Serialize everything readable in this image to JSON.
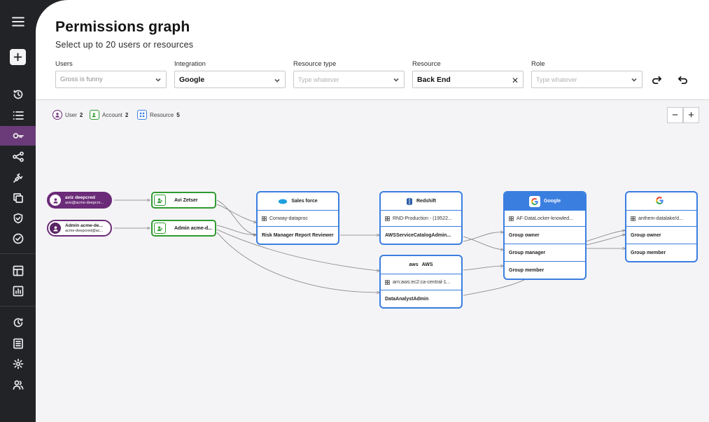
{
  "page": {
    "title": "Permissions graph",
    "subtitle": "Select up to 20 users or resources"
  },
  "sidebar": {
    "menu_icon": "hamburger-icon",
    "add_icon": "plus-icon",
    "items": [
      {
        "icon": "history-icon"
      },
      {
        "icon": "list-icon"
      },
      {
        "icon": "key-icon",
        "active": true
      },
      {
        "icon": "share-icon"
      },
      {
        "icon": "plug-icon"
      },
      {
        "icon": "copy-icon"
      },
      {
        "icon": "shield-icon"
      },
      {
        "icon": "check-circle-icon"
      },
      {
        "icon": "layout-icon"
      },
      {
        "icon": "bar-chart-icon"
      },
      {
        "icon": "refresh-icon"
      },
      {
        "icon": "document-list-icon"
      },
      {
        "icon": "settings-icon"
      },
      {
        "icon": "users-icon"
      }
    ]
  },
  "filters": {
    "users": {
      "label": "Users",
      "value": "Gross is funny"
    },
    "integration": {
      "label": "Integration",
      "value": "Google"
    },
    "resource_type": {
      "label": "Resource type",
      "placeholder": "Type whatever"
    },
    "resource": {
      "label": "Resource",
      "value": "Back End"
    },
    "role": {
      "label": "Role",
      "placeholder": "Type whatever"
    }
  },
  "toolbar": {
    "redo_icon": "redo-icon",
    "undo_icon": "undo-icon"
  },
  "legend": {
    "user": {
      "label": "User",
      "count": "2"
    },
    "account": {
      "label": "Account",
      "count": "2"
    },
    "resource": {
      "label": "Resource",
      "count": "5"
    }
  },
  "zoom": {
    "out": "−",
    "in": "+"
  },
  "graph": {
    "users": [
      {
        "name": "aviz deepcred",
        "email": "aviz@acme-deepcre..."
      },
      {
        "name": "Admin acme-de...",
        "email": "acme-deepcred@ac..."
      }
    ],
    "accounts": [
      {
        "name": "Avi Zetser"
      },
      {
        "name": "Admin acme-d..."
      }
    ],
    "resources": {
      "salesforce": {
        "title": "Sales force",
        "sub": "Conway-dataproc",
        "rows": [
          "Risk Manager Report Reviewer"
        ]
      },
      "redshift": {
        "title": "Redshift",
        "sub": "RND-Production - (19522...",
        "rows": [
          "AWSServiceCatalogAdmin..."
        ]
      },
      "aws": {
        "title": "AWS",
        "sub": "arn:aws:ec2:ca-central-1...",
        "rows": [
          "DataAnalystAdmin"
        ]
      },
      "google1": {
        "title": "Google",
        "sub": "AF-DataLocker-knowled...",
        "rows": [
          "Group owner",
          "Group manager",
          "Group member"
        ]
      },
      "google2": {
        "title": "",
        "sub": "anthem-datalake/d...",
        "rows": [
          "Group owner",
          "Group member"
        ]
      }
    }
  },
  "colors": {
    "sidebar_bg": "#222326",
    "sidebar_active": "#6a3b78",
    "user": "#6b2b78",
    "account": "#2f9a2f",
    "resource": "#3a7ee0",
    "canvas_bg": "#f4f4f6"
  }
}
